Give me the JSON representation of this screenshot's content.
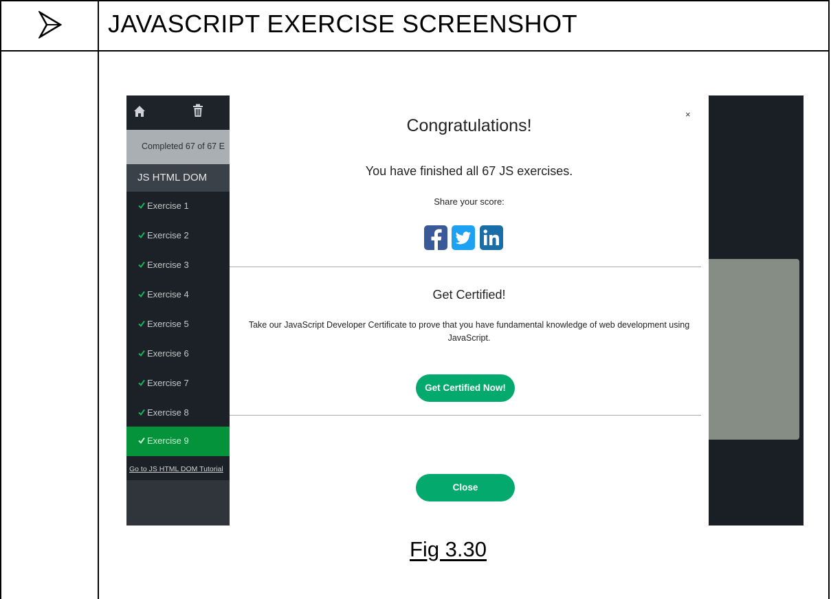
{
  "document": {
    "heading": "JAVASCRIPT EXERCISE SCREENSHOT",
    "caption": "Fig 3.30"
  },
  "sidebar": {
    "progress_text": "Completed 67 of 67 E",
    "section_title": "JS HTML DOM",
    "items": [
      {
        "label": "Exercise 1"
      },
      {
        "label": "Exercise 2"
      },
      {
        "label": "Exercise 3"
      },
      {
        "label": "Exercise 4"
      },
      {
        "label": "Exercise 5"
      },
      {
        "label": "Exercise 6"
      },
      {
        "label": "Exercise 7"
      },
      {
        "label": "Exercise 8"
      },
      {
        "label": "Exercise 9"
      }
    ],
    "active_item": "Exercise 9",
    "tutorial_link": "Go to JS HTML DOM Tutorial"
  },
  "modal": {
    "close_symbol": "×",
    "title": "Congratulations!",
    "finished_text": "You have finished all 67 JS exercises.",
    "share_label": "Share your score:",
    "social_icons": [
      "facebook-icon",
      "twitter-icon",
      "linkedin-icon"
    ],
    "cert_title": "Get Certified!",
    "cert_description": "Take our JavaScript Developer Certificate to prove that you have fundamental knowledge of web development using JavaScript.",
    "cert_button": "Get Certified Now!",
    "close_button": "Close"
  },
  "colors": {
    "accent_green": "#04aa6d",
    "active_item_green": "#04933b",
    "facebook_blue": "#3a5998",
    "twitter_blue": "#1da1f2",
    "linkedin_blue": "#1a6ea8"
  }
}
